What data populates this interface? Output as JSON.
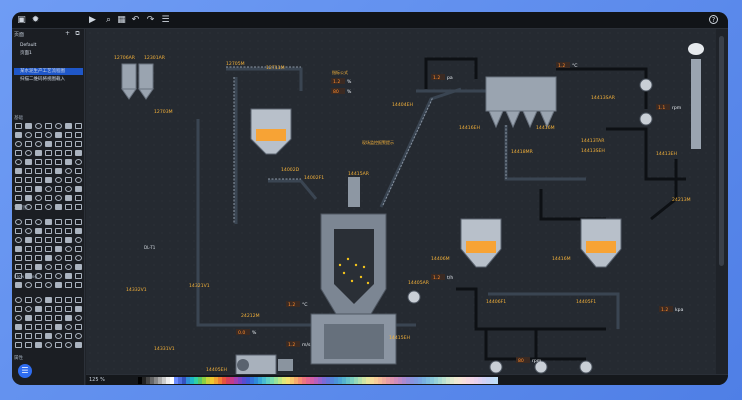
{
  "topbar": {
    "buttons": [
      "save-icon",
      "settings-icon",
      "play-icon",
      "search-icon",
      "grid-icon",
      "undo-icon",
      "redo-icon",
      "list-icon"
    ],
    "help": "?"
  },
  "left_panel": {
    "pages_header": "页面",
    "tree": [
      {
        "label": "Default"
      },
      {
        "label": "页面1"
      },
      {
        "label": "某水泥生产工艺流程图",
        "selected": true
      },
      {
        "label": "扫描二维码将视图载入",
        "selected": false
      }
    ],
    "sections": {
      "basic": "基础",
      "flow": "流程图",
      "chart": "图表",
      "more": "Flow / Img",
      "props": "属性"
    }
  },
  "bottom": {
    "zoom": "125 %"
  },
  "diagram": {
    "tags": {
      "a": "12706AR",
      "b": "12301AR",
      "c": "12703M",
      "d": "12201M",
      "e": "12704M",
      "f": "12207AR",
      "g": "12201AR",
      "h": "12705M",
      "i": "12711M",
      "j": "14002D",
      "k": "14002F1",
      "l": "14415AR",
      "m": "14415EH",
      "n": "14416EH",
      "o": "14417MM",
      "p": "14415M",
      "q": "14406M",
      "r": "14416M",
      "s": "14403EH",
      "t": "14418MR",
      "u": "14413SAR",
      "v": "14413AR",
      "w": "14413EH",
      "x": "14413TAR",
      "y": "14413SEH",
      "z": "14413EH",
      "aa": "24213M",
      "ab": "14412MR",
      "ac": "14405AR",
      "ad": "14406F1",
      "ae": "14405F1",
      "af": "14332V1",
      "ag": "14321V1",
      "ah": "24212M",
      "ai": "14331V1",
      "aj": "14405EH",
      "ak": "14411M",
      "al": "14407M",
      "am": "14416M",
      "an": "14404EH",
      "ao": "14416EH",
      "ap": "14405AR"
    },
    "notes": {
      "formula": "指标公式",
      "note2": "现场监控报警提示",
      "dl1": "DL-T1"
    },
    "values": {
      "v1": "1.2",
      "v2": "0.0",
      "v3": "1.1",
      "v4": "80"
    },
    "units": {
      "A": "A",
      "C": "°C",
      "pct": "%",
      "th": "t/h",
      "rpm": "rpm",
      "kpa": "kpa",
      "ms": "m/s",
      "mm": "mm",
      "pa": "pa"
    }
  }
}
